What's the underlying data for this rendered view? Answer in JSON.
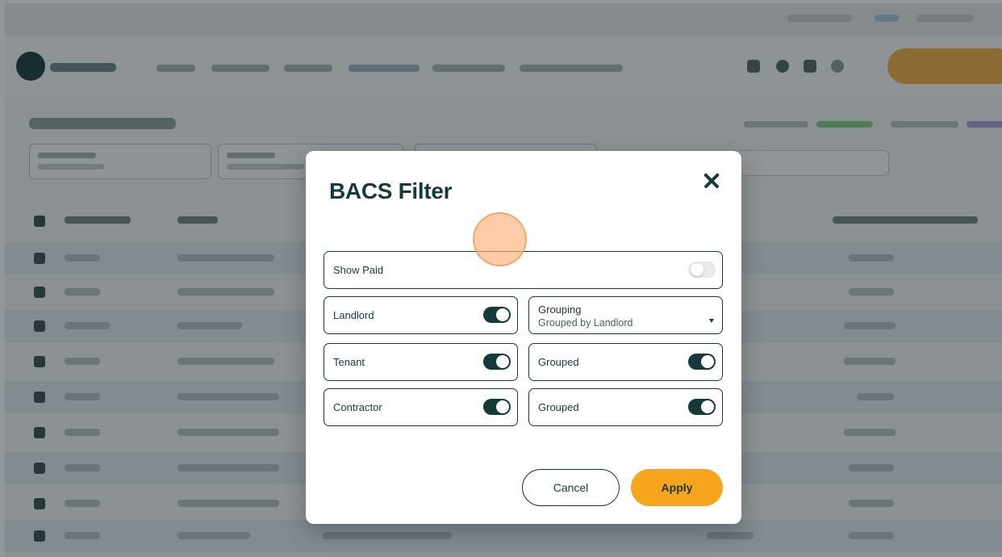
{
  "modal": {
    "title": "BACS Filter",
    "show_paid": {
      "label": "Show Paid",
      "checked": false
    },
    "landlord": {
      "label": "Landlord",
      "checked": true
    },
    "grouping": {
      "label": "Grouping",
      "value": "Grouped by Landlord"
    },
    "tenant": {
      "label": "Tenant",
      "checked": true
    },
    "tenant_grouped": {
      "label": "Grouped",
      "checked": true
    },
    "contractor": {
      "label": "Contractor",
      "checked": true
    },
    "contractor_grouped": {
      "label": "Grouped",
      "checked": true
    },
    "cancel_label": "Cancel",
    "apply_label": "Apply"
  },
  "colors": {
    "primary": "#143a3a",
    "accent": "#f6a51c",
    "overlay": "rgba(20,28,32,0.46)"
  },
  "icons": [
    "close-icon",
    "chevron-down-icon",
    "notification-icon",
    "search-icon",
    "user-icon"
  ]
}
